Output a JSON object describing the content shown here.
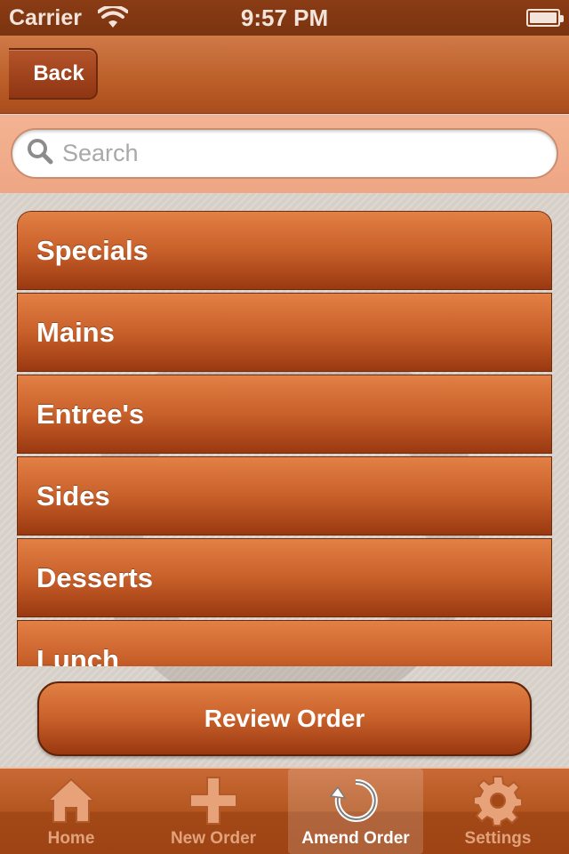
{
  "status_bar": {
    "carrier": "Carrier",
    "time": "9:57 PM"
  },
  "nav": {
    "back_label": "Back"
  },
  "search": {
    "placeholder": "Search"
  },
  "menu": {
    "items": [
      {
        "label": "Specials"
      },
      {
        "label": "Mains"
      },
      {
        "label": "Entree's"
      },
      {
        "label": "Sides"
      },
      {
        "label": "Desserts"
      },
      {
        "label": "Lunch"
      }
    ]
  },
  "review_button": {
    "label": "Review Order"
  },
  "tabs": [
    {
      "label": "Home",
      "icon": "home-icon",
      "active": false
    },
    {
      "label": "New Order",
      "icon": "plus-icon",
      "active": false
    },
    {
      "label": "Amend Order",
      "icon": "refresh-icon",
      "active": true
    },
    {
      "label": "Settings",
      "icon": "gear-icon",
      "active": false
    }
  ],
  "colors": {
    "brand": "#c8602a",
    "brand_dark": "#9a3810",
    "search_bg": "#f3b393",
    "active_tab_label": "#ffffff",
    "inactive_tab_label": "#e2a27c"
  }
}
